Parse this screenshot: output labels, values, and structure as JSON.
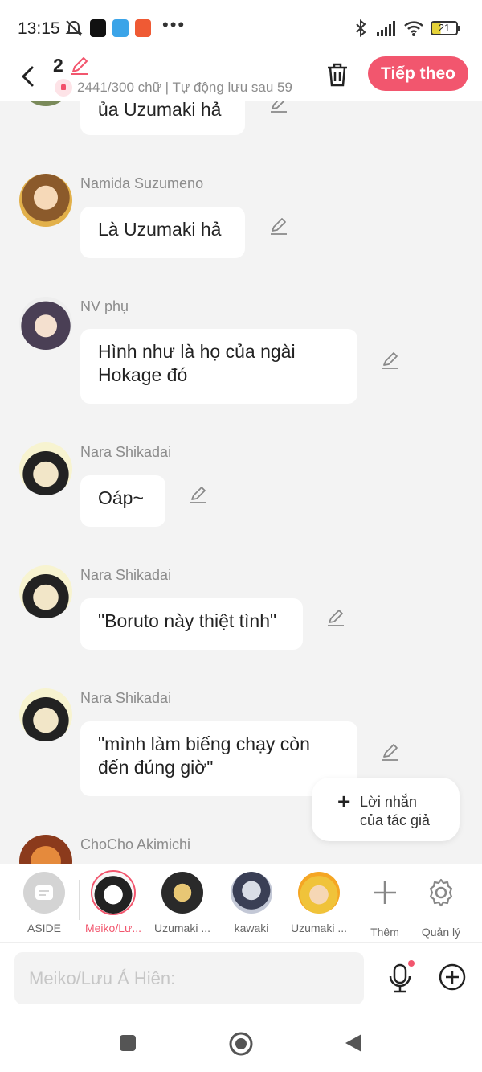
{
  "status_bar": {
    "time": "13:15",
    "battery": "21",
    "more": "•••"
  },
  "header": {
    "chapter_number": "2",
    "word_count": "2441/300 chữ | Tự động lưu sau 59",
    "next_label": "Tiếp theo"
  },
  "messages": [
    {
      "name": "",
      "text": "ủa Uzumaki hả"
    },
    {
      "name": "Namida Suzumeno",
      "text": "Là Uzumaki hả"
    },
    {
      "name": "NV phụ",
      "text": "Hình như là họ của ngài\nHokage đó"
    },
    {
      "name": "Nara Shikadai",
      "text": "Oáp~"
    },
    {
      "name": "Nara Shikadai",
      "text": "\"Boruto này thiệt tình\""
    },
    {
      "name": "Nara Shikadai",
      "text": "\"mình làm biếng chạy còn\nđến đúng giờ\""
    },
    {
      "name": "ChoCho Akimichi",
      "text": ""
    }
  ],
  "author_note": {
    "plus": "+",
    "label": "Lời nhắn\ncủa tác giả"
  },
  "characters": [
    {
      "name": "ASIDE"
    },
    {
      "name": "Meiko/Lư..."
    },
    {
      "name": "Uzumaki ..."
    },
    {
      "name": "kawaki"
    },
    {
      "name": "Uzumaki ..."
    },
    {
      "name": "Thêm"
    },
    {
      "name": "Quản lý"
    }
  ],
  "input": {
    "placeholder": "Meiko/Lưu Á Hiên:"
  },
  "colors": {
    "accent": "#f2566e",
    "background": "#f3f3f3"
  }
}
